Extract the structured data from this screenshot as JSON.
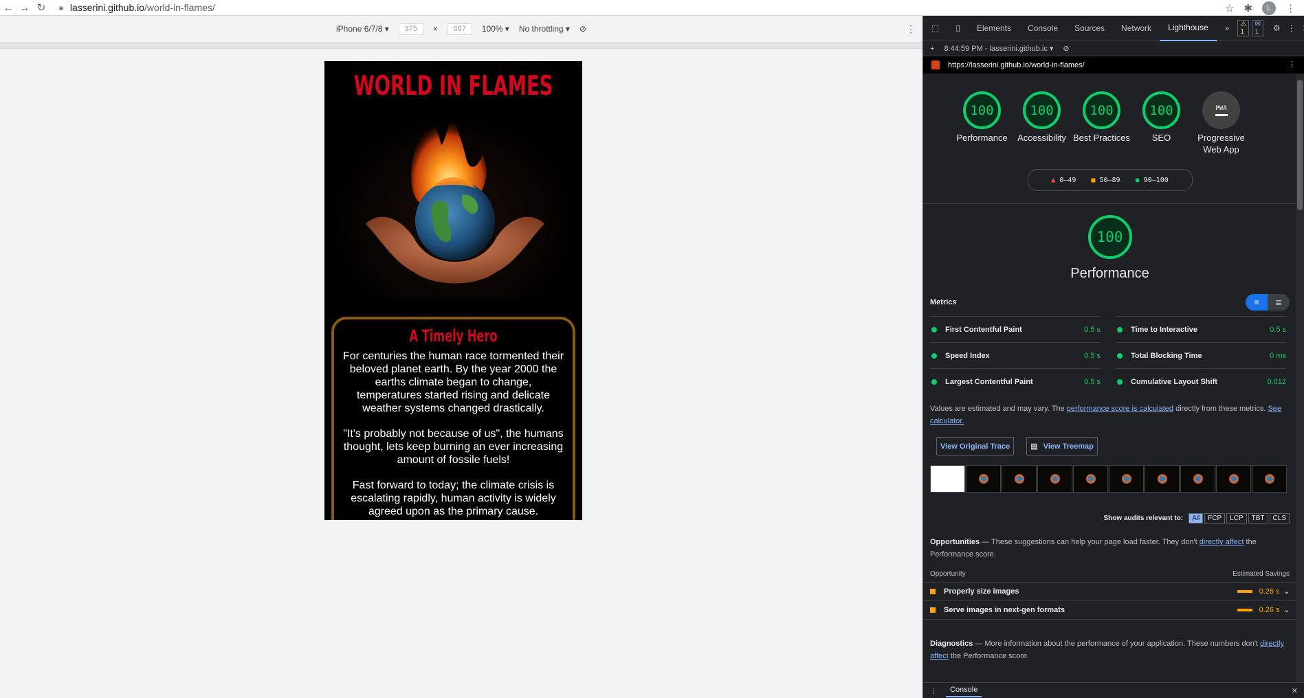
{
  "browser": {
    "url_host": "lasserini.github.io",
    "url_path": "/world-in-flames/",
    "avatar_letter": "L"
  },
  "device_toolbar": {
    "device": "iPhone 6/7/8 ▾",
    "width": "375",
    "times": "×",
    "height": "667",
    "zoom": "100% ▾",
    "throttle": "No throttling ▾"
  },
  "site": {
    "title": "WORLD IN FLAMES",
    "card_heading": "A Timely Hero",
    "paragraphs": [
      "For centuries the human race tormented their beloved planet earth. By the year 2000 the earths climate began to change, temperatures started rising and delicate weather systems changed drastically.",
      "\"It's probably not because of us\", the humans thought, lets keep burning an ever increasing amount of fossile fuels!",
      "Fast forward to today; the climate crisis is escalating rapidly, human activity is widely agreed upon as the primary cause."
    ]
  },
  "devtools": {
    "tabs": [
      "Elements",
      "Console",
      "Sources",
      "Network",
      "Lighthouse"
    ],
    "more": "»",
    "warnings": "1",
    "messages": "1",
    "report_time": "8:44:59 PM - lasserini.github.ic ▾",
    "report_url": "https://lasserini.github.io/world-in-flames/"
  },
  "lighthouse": {
    "gauges": [
      {
        "score": "100",
        "label": "Performance"
      },
      {
        "score": "100",
        "label": "Accessibility"
      },
      {
        "score": "100",
        "label": "Best Practices"
      },
      {
        "score": "100",
        "label": "SEO"
      }
    ],
    "pwa": {
      "badge": "PWA",
      "label": "Progressive Web App"
    },
    "legend": {
      "fail": "0–49",
      "average": "50–89",
      "pass": "90–100"
    },
    "perf_score": "100",
    "perf_label": "Performance",
    "metrics_title": "Metrics",
    "metrics": [
      {
        "name": "First Contentful Paint",
        "value": "0.5 s"
      },
      {
        "name": "Time to Interactive",
        "value": "0.5 s"
      },
      {
        "name": "Speed Index",
        "value": "0.5 s"
      },
      {
        "name": "Total Blocking Time",
        "value": "0 ms"
      },
      {
        "name": "Largest Contentful Paint",
        "value": "0.5 s"
      },
      {
        "name": "Cumulative Layout Shift",
        "value": "0.012"
      }
    ],
    "note_prefix": "Values are estimated and may vary. The ",
    "note_link": "performance score is calculated",
    "note_mid": " directly from these metrics. ",
    "note_link2": "See calculator.",
    "btn_trace": "View Original Trace",
    "btn_treemap": "View Treemap",
    "filter_label": "Show audits relevant to:",
    "filters": [
      "All",
      "FCP",
      "LCP",
      "TBT",
      "CLS"
    ],
    "opp_title": "Opportunities",
    "opp_desc_a": " — These suggestions can help your page load faster. They don't ",
    "opp_link": "directly affect",
    "opp_desc_b": " the Performance score.",
    "opp_col1": "Opportunity",
    "opp_col2": "Estimated Savings",
    "opportunities": [
      {
        "name": "Properly size images",
        "value": "0.26 s"
      },
      {
        "name": "Serve images in next-gen formats",
        "value": "0.26 s"
      }
    ],
    "diag_title": "Diagnostics",
    "diag_desc_a": " — More information about the performance of your application. These numbers don't ",
    "diag_link": "directly affect",
    "diag_desc_b": " the Performance score."
  },
  "console_drawer": {
    "label": "Console"
  }
}
